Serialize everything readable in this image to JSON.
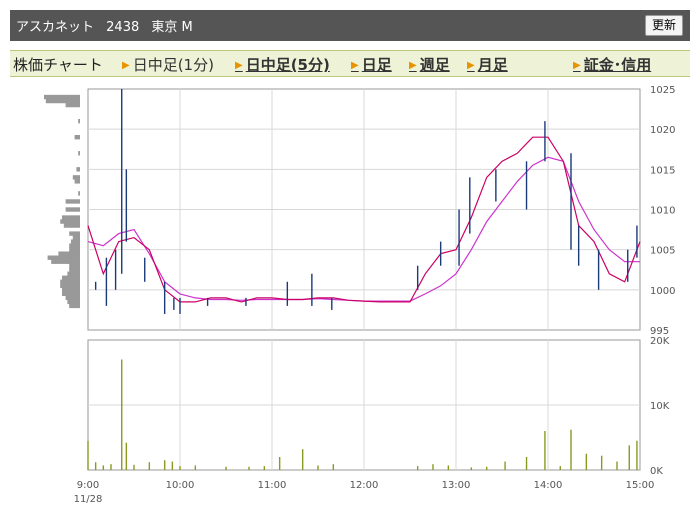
{
  "header": {
    "company": "アスカネット",
    "code": "2438",
    "market": "東京 M",
    "refresh_label": "更新"
  },
  "nav": {
    "label": "株価チャート",
    "intraday_1min": "日中足(1分)",
    "intraday_5min": "日中足(5分)",
    "daily": "日足",
    "weekly": "週足",
    "monthly": "月足",
    "margin": "証金･信用"
  },
  "colors": {
    "nav_bg": "#eef3d7",
    "ma_short": "#cc0066",
    "ma_long": "#cc33cc",
    "candle": "#1a3a7a",
    "volume_bar": "#8a9a20",
    "volume_profile": "#999999"
  },
  "chart_data": {
    "type": "line",
    "price_axis": {
      "ticks": [
        995,
        1000,
        1005,
        1010,
        1015,
        1020,
        1025
      ],
      "ylim": [
        995,
        1025
      ]
    },
    "volume_axis": {
      "ticks": [
        "0K",
        "10K",
        "20K"
      ],
      "ylim": [
        0,
        20000
      ]
    },
    "x_ticks": [
      "9:00",
      "10:00",
      "11:00",
      "12:00",
      "13:00",
      "14:00",
      "15:00"
    ],
    "x_sub_label": "11/28",
    "xlim_minutes": [
      540,
      900
    ],
    "series": [
      {
        "x": [
          540,
          550,
          560,
          570,
          580,
          590,
          600,
          610,
          620,
          630,
          640,
          650,
          660,
          670,
          680,
          690,
          700,
          710,
          720,
          730,
          740,
          750,
          760,
          770,
          780,
          790,
          800,
          810,
          820,
          830,
          840,
          850,
          860,
          870,
          880,
          890,
          900
        ],
        "values": [
          1008,
          1002,
          1006,
          1006.5,
          1005,
          1000,
          998.5,
          998.5,
          999,
          999,
          998.5,
          999,
          999,
          998.8,
          998.8,
          999,
          999,
          998.7,
          998.6,
          998.5,
          998.5,
          998.5,
          1002,
          1004.5,
          1005,
          1009,
          1014,
          1016,
          1017,
          1019,
          1019,
          1016,
          1008,
          1006,
          1002,
          1001,
          1006
        ]
      },
      {
        "x": [
          540,
          550,
          560,
          570,
          580,
          590,
          600,
          610,
          620,
          630,
          640,
          650,
          660,
          670,
          680,
          690,
          700,
          710,
          720,
          730,
          740,
          750,
          760,
          770,
          780,
          790,
          800,
          810,
          820,
          830,
          840,
          850,
          860,
          870,
          880,
          890,
          900
        ],
        "values": [
          1006,
          1005.5,
          1007,
          1007.5,
          1004.5,
          1001,
          999.5,
          999,
          998.8,
          998.8,
          998.7,
          998.8,
          998.8,
          998.8,
          998.8,
          998.9,
          998.8,
          998.7,
          998.6,
          998.6,
          998.6,
          998.6,
          999.5,
          1000.5,
          1002,
          1005,
          1008.5,
          1011,
          1013.5,
          1015.5,
          1016.5,
          1016,
          1011,
          1007.5,
          1005,
          1003.5,
          1003.5
        ]
      }
    ],
    "candles": [
      {
        "x": 545,
        "hi": 1001,
        "lo": 1000
      },
      {
        "x": 552,
        "hi": 1004,
        "lo": 998
      },
      {
        "x": 558,
        "hi": 1005,
        "lo": 1000
      },
      {
        "x": 562,
        "hi": 1025,
        "lo": 1002
      },
      {
        "x": 565,
        "hi": 1015,
        "lo": 1006
      },
      {
        "x": 577,
        "hi": 1004,
        "lo": 1001
      },
      {
        "x": 590,
        "hi": 1001,
        "lo": 997
      },
      {
        "x": 596,
        "hi": 999,
        "lo": 997.5
      },
      {
        "x": 600,
        "hi": 999,
        "lo": 997
      },
      {
        "x": 618,
        "hi": 999,
        "lo": 998
      },
      {
        "x": 643,
        "hi": 999,
        "lo": 998
      },
      {
        "x": 670,
        "hi": 1001,
        "lo": 998
      },
      {
        "x": 686,
        "hi": 1002,
        "lo": 998
      },
      {
        "x": 699,
        "hi": 999,
        "lo": 997.5
      },
      {
        "x": 755,
        "hi": 1003,
        "lo": 1000
      },
      {
        "x": 770,
        "hi": 1006,
        "lo": 1003
      },
      {
        "x": 782,
        "hi": 1010,
        "lo": 1003
      },
      {
        "x": 789,
        "hi": 1014,
        "lo": 1007
      },
      {
        "x": 806,
        "hi": 1015,
        "lo": 1011
      },
      {
        "x": 826,
        "hi": 1016,
        "lo": 1010
      },
      {
        "x": 838,
        "hi": 1021,
        "lo": 1016
      },
      {
        "x": 855,
        "hi": 1017,
        "lo": 1005
      },
      {
        "x": 860,
        "hi": 1008,
        "lo": 1003
      },
      {
        "x": 873,
        "hi": 1005,
        "lo": 1000
      },
      {
        "x": 892,
        "hi": 1005,
        "lo": 1001
      },
      {
        "x": 898,
        "hi": 1008,
        "lo": 1004
      }
    ],
    "volume": {
      "x": [
        540,
        545,
        550,
        555,
        562,
        565,
        570,
        580,
        590,
        595,
        600,
        610,
        630,
        645,
        655,
        665,
        680,
        690,
        700,
        755,
        765,
        775,
        790,
        800,
        812,
        826,
        838,
        848,
        855,
        865,
        875,
        885,
        893,
        898
      ],
      "values": [
        4500,
        1200,
        700,
        900,
        17000,
        4200,
        800,
        1200,
        1500,
        1300,
        600,
        700,
        500,
        500,
        600,
        2000,
        3200,
        700,
        900,
        600,
        900,
        700,
        400,
        500,
        1300,
        2000,
        6000,
        600,
        6200,
        2500,
        2200,
        1300,
        3800,
        4500
      ]
    },
    "volume_profile": [
      {
        "price": 1024,
        "size": 1
      },
      {
        "price": 1023.5,
        "size": 0.95
      },
      {
        "price": 1023,
        "size": 0.4
      },
      {
        "price": 1021,
        "size": 0.05
      },
      {
        "price": 1019,
        "size": 0.15
      },
      {
        "price": 1017,
        "size": 0.05
      },
      {
        "price": 1015,
        "size": 0.1
      },
      {
        "price": 1014,
        "size": 0.2
      },
      {
        "price": 1013.5,
        "size": 0.15
      },
      {
        "price": 1012,
        "size": 0.05
      },
      {
        "price": 1011,
        "size": 0.4
      },
      {
        "price": 1010,
        "size": 0.4
      },
      {
        "price": 1009,
        "size": 0.5
      },
      {
        "price": 1008.5,
        "size": 0.55
      },
      {
        "price": 1008,
        "size": 0.45
      },
      {
        "price": 1007,
        "size": 0.3
      },
      {
        "price": 1006.5,
        "size": 0.2
      },
      {
        "price": 1006,
        "size": 0.25
      },
      {
        "price": 1005.5,
        "size": 0.3
      },
      {
        "price": 1005,
        "size": 0.3
      },
      {
        "price": 1004.5,
        "size": 0.6
      },
      {
        "price": 1004,
        "size": 0.9
      },
      {
        "price": 1003.5,
        "size": 0.8
      },
      {
        "price": 1003,
        "size": 0.3
      },
      {
        "price": 1002.5,
        "size": 0.3
      },
      {
        "price": 1002,
        "size": 0.35
      },
      {
        "price": 1001.5,
        "size": 0.5
      },
      {
        "price": 1001,
        "size": 0.55
      },
      {
        "price": 1000.5,
        "size": 0.55
      },
      {
        "price": 1000,
        "size": 0.5
      },
      {
        "price": 999.5,
        "size": 0.5
      },
      {
        "price": 999,
        "size": 0.4
      },
      {
        "price": 998.5,
        "size": 0.35
      },
      {
        "price": 998,
        "size": 0.3
      }
    ]
  }
}
